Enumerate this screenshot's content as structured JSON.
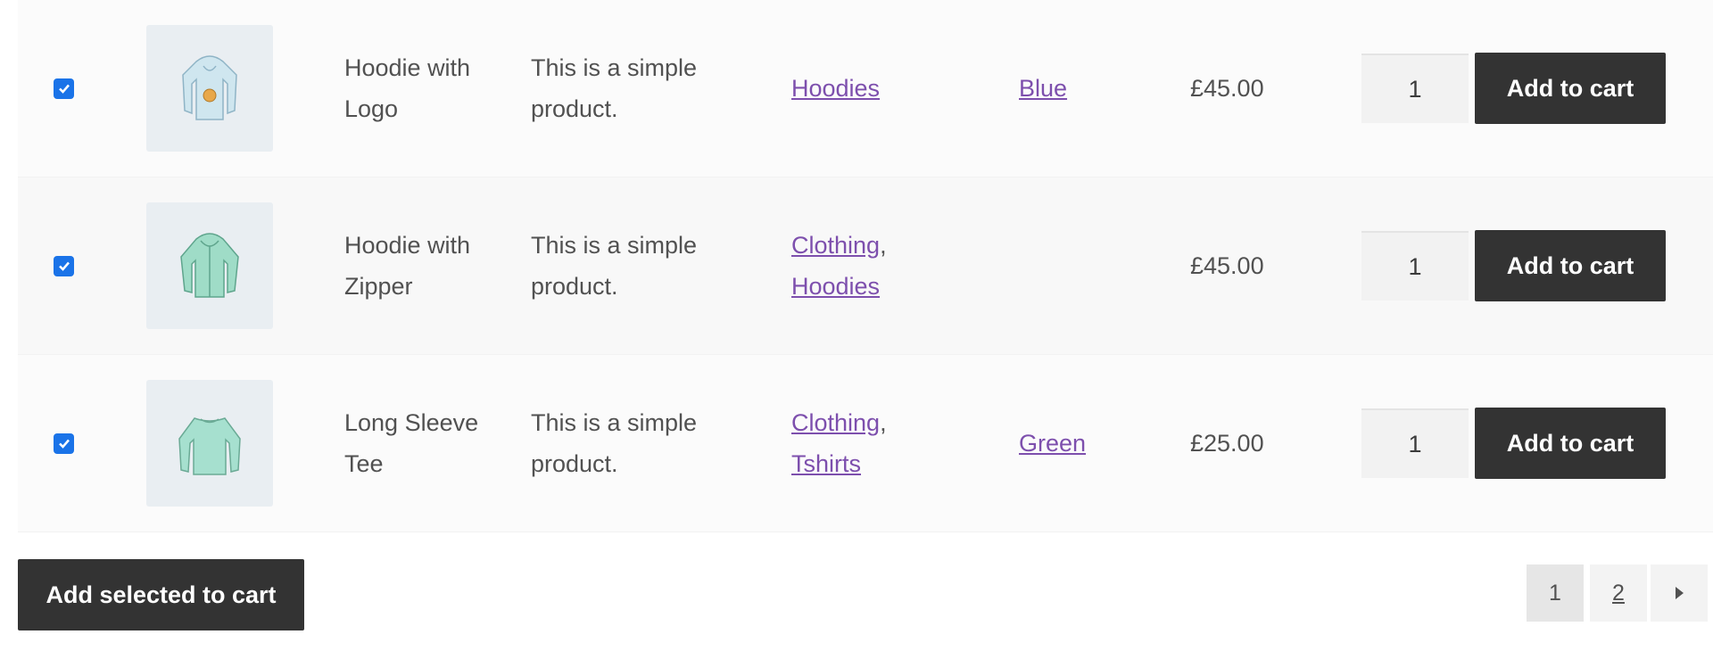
{
  "rows": [
    {
      "checked": true,
      "image_icon": "hoodie-with-logo-image",
      "name": "Hoodie with Logo",
      "description": "This is a simple product.",
      "categories": [
        "Hoodies"
      ],
      "attribute": "Blue",
      "price": "£45.00",
      "quantity": "1",
      "add_label": "Add to cart"
    },
    {
      "checked": true,
      "image_icon": "hoodie-with-zipper-image",
      "name": "Hoodie with Zipper",
      "description": "This is a simple product.",
      "categories": [
        "Clothing",
        "Hoodies"
      ],
      "attribute": "",
      "price": "£45.00",
      "quantity": "1",
      "add_label": "Add to cart"
    },
    {
      "checked": true,
      "image_icon": "long-sleeve-tee-image",
      "name": "Long Sleeve Tee",
      "description": "This is a simple product.",
      "categories": [
        "Clothing",
        "Tshirts"
      ],
      "attribute": "Green",
      "price": "£25.00",
      "quantity": "1",
      "add_label": "Add to cart"
    }
  ],
  "footer": {
    "add_selected_label": "Add selected to cart"
  },
  "pagination": {
    "current": "1",
    "next_page": "2",
    "next_icon": "chevron-right-icon"
  },
  "colors": {
    "link": "#7d4fad",
    "button_bg": "#333333",
    "checkbox": "#1a73e8"
  }
}
